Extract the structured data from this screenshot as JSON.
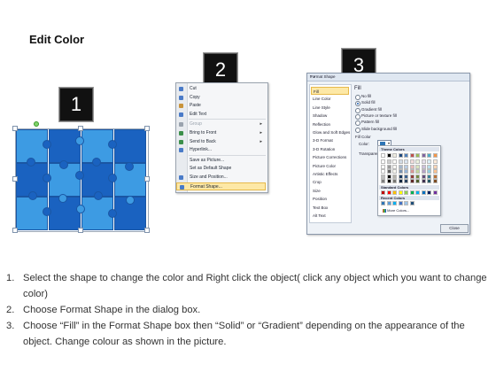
{
  "title": "Edit Color",
  "numbers": [
    "1",
    "2",
    "3"
  ],
  "context_menu": {
    "items": [
      {
        "label": "Cut",
        "icon": "scissors-icon",
        "color": "#4a7bc8",
        "arrow": false,
        "enabled": true
      },
      {
        "label": "Copy",
        "icon": "copy-icon",
        "color": "#4a7bc8",
        "arrow": false,
        "enabled": true
      },
      {
        "label": "Paste",
        "icon": "paste-icon",
        "color": "#c8933a",
        "arrow": false,
        "enabled": true
      },
      {
        "label": "Edit Text",
        "icon": "edit-text-icon",
        "color": "#4a7bc8",
        "arrow": false,
        "enabled": true
      },
      {
        "label": "Group",
        "icon": "group-icon",
        "color": "#9aa3ae",
        "arrow": true,
        "enabled": false
      },
      {
        "label": "Bring to Front",
        "icon": "bring-front-icon",
        "color": "#3b8f4a",
        "arrow": true,
        "enabled": true
      },
      {
        "label": "Send to Back",
        "icon": "send-back-icon",
        "color": "#3b8f4a",
        "arrow": true,
        "enabled": true
      },
      {
        "label": "Hyperlink...",
        "icon": "hyperlink-icon",
        "color": "#4a7bc8",
        "arrow": false,
        "enabled": true
      },
      {
        "label": "Save as Picture...",
        "icon": "",
        "color": "",
        "arrow": false,
        "enabled": true
      },
      {
        "label": "Set as Default Shape",
        "icon": "",
        "color": "",
        "arrow": false,
        "enabled": true
      },
      {
        "label": "Size and Position...",
        "icon": "size-position-icon",
        "color": "#4a7bc8",
        "arrow": false,
        "enabled": true
      },
      {
        "label": "Format Shape...",
        "icon": "format-shape-icon",
        "color": "#4a7bc8",
        "arrow": false,
        "enabled": true,
        "highlighted": true
      }
    ]
  },
  "dialog": {
    "title": "Format Shape",
    "title_buttons": "? ×",
    "nav": [
      "Fill",
      "Line Color",
      "Line Style",
      "Shadow",
      "Reflection",
      "Glow and Soft Edges",
      "3-D Format",
      "3-D Rotation",
      "Picture Corrections",
      "Picture Color",
      "Artistic Effects",
      "Crop",
      "Size",
      "Position",
      "Text Box",
      "Alt Text"
    ],
    "selected_nav": "Fill",
    "fill_heading": "Fill",
    "fill_options": [
      {
        "label": "No fill",
        "checked": false
      },
      {
        "label": "Solid fill",
        "checked": true
      },
      {
        "label": "Gradient fill",
        "checked": false
      },
      {
        "label": "Picture or texture fill",
        "checked": false
      },
      {
        "label": "Pattern fill",
        "checked": false
      },
      {
        "label": "Slide background fill",
        "checked": false
      }
    ],
    "fill_color_label": "Fill Color",
    "color_label": "Color:",
    "transparency_label": "Transparency:",
    "palette": {
      "theme_header": "Theme Colors",
      "standard_header": "Standard Colors",
      "recent_header": "Recent Colors",
      "more_colors": "More Colors...",
      "theme_top": [
        "#ffffff",
        "#000000",
        "#eeece1",
        "#1f497d",
        "#4f81bd",
        "#c0504d",
        "#9bbb59",
        "#8064a2",
        "#4bacc6",
        "#f79646"
      ],
      "standard": [
        "#c00000",
        "#ff0000",
        "#ffc000",
        "#ffff00",
        "#92d050",
        "#00b050",
        "#00b0f0",
        "#0070c0",
        "#002060",
        "#7030a0"
      ],
      "recent": [
        "#2e75b6",
        "#5b9bd5",
        "#00b0f0",
        "#4472c4",
        "#9dc3e6",
        "#1f4e79"
      ]
    },
    "close_label": "Close"
  },
  "steps": [
    {
      "num": "1.",
      "text": "Select the shape to change the color and Right click the object( click any object which you want to change color)"
    },
    {
      "num": "2.",
      "text": "Choose Format Shape in the dialog box."
    },
    {
      "num": "3.",
      "text": "Choose “Fill” in the Format Shape box then “Solid” or “Gradient” depending on the appearance of the object. Change colour as shown in the picture."
    }
  ],
  "colors": {
    "puzzle_light": "#3d9be3",
    "puzzle_dark": "#1a62c0",
    "highlight": "#fde8a6"
  }
}
